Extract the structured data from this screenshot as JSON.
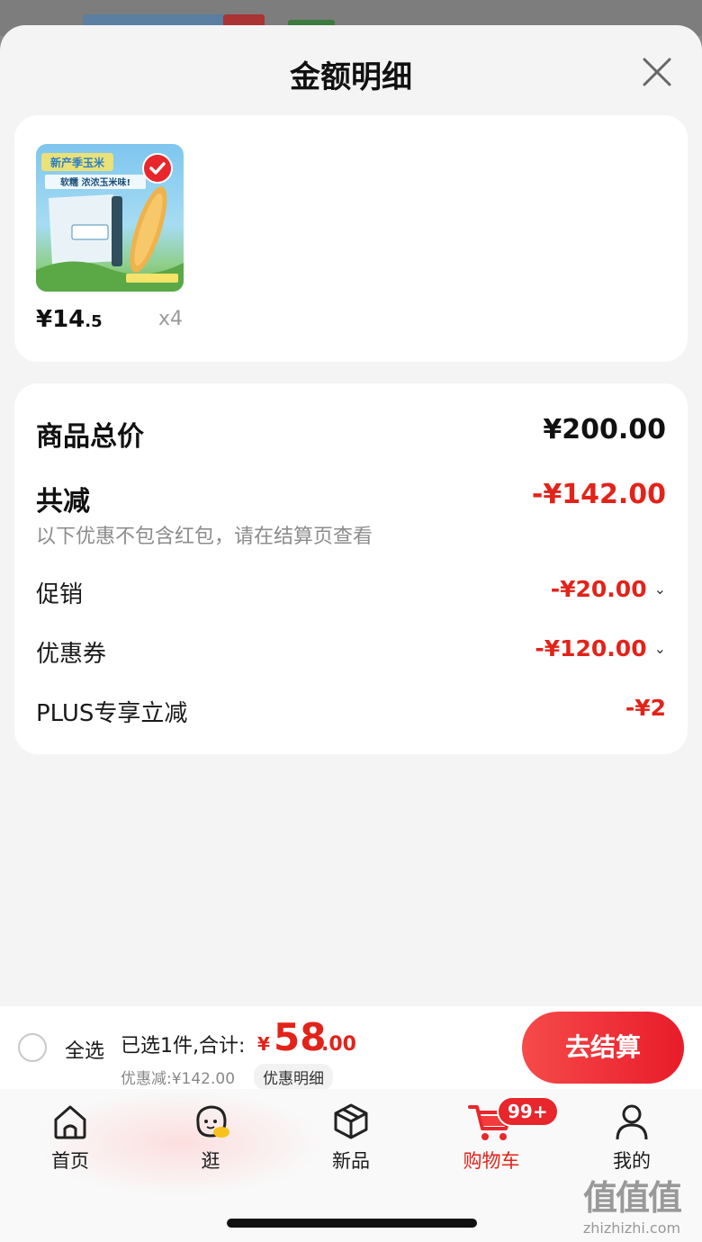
{
  "sheet": {
    "title": "金额明细"
  },
  "product": {
    "image_text_top": "新产季玉米",
    "image_text_sub": "软糯 浓浓玉米味!",
    "price_int": "¥14",
    "price_dec": ".5",
    "quantity": "x4"
  },
  "summary": {
    "total_label": "商品总价",
    "total_value": "¥200.00",
    "reduce_label": "共减",
    "reduce_value": "-¥142.00",
    "reduce_note": "以下优惠不包含红包，请在结算页查看",
    "items": [
      {
        "label": "促销",
        "value": "-¥20.00",
        "expandable": true
      },
      {
        "label": "优惠券",
        "value": "-¥120.00",
        "expandable": true
      },
      {
        "label": "PLUS专享立减",
        "value": "-¥2",
        "expandable": false
      }
    ]
  },
  "bottom_bar": {
    "select_all": "全选",
    "selected": "已选1件,合计:",
    "currency": "¥",
    "total_int": "58",
    "total_dec": ".00",
    "discount_note": "优惠减:¥142.00",
    "detail_link": "优惠明细",
    "checkout": "去结算"
  },
  "tabbar": {
    "tabs": [
      {
        "label": "首页",
        "icon": "home-icon",
        "active": false
      },
      {
        "label": "逛",
        "icon": "browse-icon",
        "active": false
      },
      {
        "label": "新品",
        "icon": "cube-icon",
        "active": false
      },
      {
        "label": "购物车",
        "icon": "cart-icon",
        "active": true
      },
      {
        "label": "我的",
        "icon": "profile-icon",
        "active": false
      }
    ],
    "cart_badge": "99+"
  },
  "watermark": {
    "main": "值值值",
    "sub": "zhizhizhi.com"
  },
  "colors": {
    "accent_red": "#e2231a",
    "checkout_gradient_start": "#f64a4a",
    "checkout_gradient_end": "#e81c2a"
  }
}
